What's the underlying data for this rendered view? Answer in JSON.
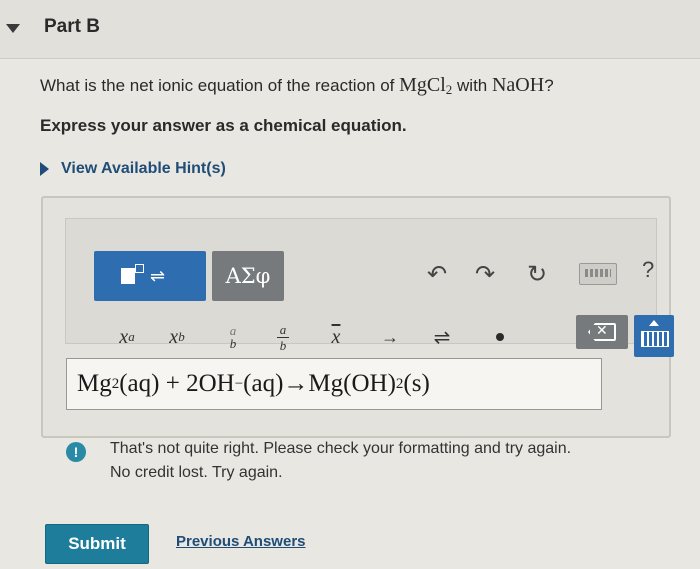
{
  "header": {
    "title": "Part B"
  },
  "question": {
    "prefix": "What is the net ionic equation of the reaction of ",
    "reactant1": "MgCl",
    "reactant1_sub": "2",
    "middle": " with ",
    "reactant2": "NaOH",
    "suffix": "?"
  },
  "instruction": "Express your answer as a chemical equation.",
  "hints": {
    "label": "View Available Hint(s)"
  },
  "toolbar": {
    "greek_label": "ΑΣφ",
    "undo_glyph": "↶",
    "redo_glyph": "↷",
    "reset_glyph": "↻",
    "help_label": "?",
    "symbols": {
      "superscript_base": "x",
      "superscript_exp": "a",
      "subscript_base": "x",
      "subscript_sub": "b",
      "frac_a": "a",
      "frac_b": "b",
      "frac2_a": "a",
      "frac2_b": "b",
      "xbar": "x",
      "arrow": "→",
      "equilibrium": "⇌",
      "delete_x": "✕"
    }
  },
  "equation": {
    "p1": "Mg",
    "p1_sup": "2",
    "p2": "(aq) + 2OH",
    "p2_sup": "−",
    "p3": " (aq)→Mg(OH)",
    "p3_sub": "2",
    "p4": "(s)"
  },
  "feedback": {
    "line1": "That's not quite right. Please check your formatting and try again.",
    "line2": "No credit lost. Try again."
  },
  "actions": {
    "submit_label": "Submit",
    "previous_answers_label": "Previous Answers"
  },
  "colors": {
    "primary_button": "#2e6db0",
    "submit_button": "#1e7d9b",
    "link": "#1f4d78",
    "warning_icon": "#2a8aa5"
  }
}
